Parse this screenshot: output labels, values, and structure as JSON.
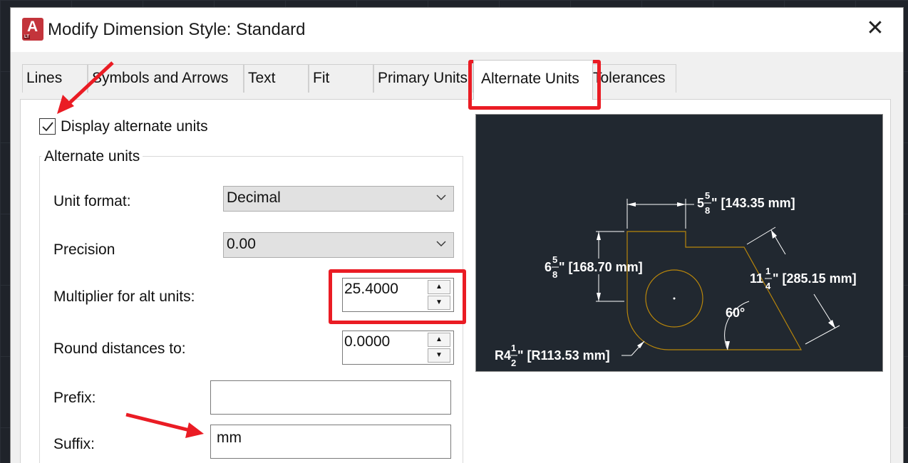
{
  "window": {
    "title": "Modify Dimension Style: Standard",
    "icon": "autocad-lt-icon",
    "close_icon": "close-icon"
  },
  "tabs": [
    {
      "label": "Lines"
    },
    {
      "label": "Symbols and Arrows"
    },
    {
      "label": "Text"
    },
    {
      "label": "Fit"
    },
    {
      "label": "Primary Units"
    },
    {
      "label": "Alternate Units"
    },
    {
      "label": "Tolerances"
    }
  ],
  "active_tab": "Alternate Units",
  "display_alt": {
    "label": "Display alternate units",
    "checked": true
  },
  "alt_units": {
    "group_title": "Alternate units",
    "unit_format": {
      "label": "Unit format:",
      "value": "Decimal"
    },
    "precision": {
      "label": "Precision",
      "value": "0.00"
    },
    "multiplier": {
      "label": "Multiplier for alt units:",
      "value": "25.4000"
    },
    "round": {
      "label": "Round distances  to:",
      "value": "0.0000"
    },
    "prefix": {
      "label": "Prefix:",
      "value": ""
    },
    "suffix": {
      "label": "Suffix:",
      "value": "mm"
    }
  },
  "preview": {
    "dim_top": {
      "whole": "5",
      "num": "5",
      "den": "8",
      "alt": "\" [143.35 mm]"
    },
    "dim_left": {
      "whole": "6",
      "num": "5",
      "den": "8",
      "alt": "\" [168.70 mm]"
    },
    "dim_diag": {
      "whole": "11",
      "num": "1",
      "den": "4",
      "alt": "\" [285.15 mm]"
    },
    "dim_radius": {
      "whole": "R4",
      "num": "1",
      "den": "2",
      "alt": "\" [R113.53 mm]"
    },
    "angle": "60°"
  },
  "colors": {
    "highlight": "#ea1c24",
    "preview_bg": "#212830",
    "geometry": "#b8860b"
  }
}
